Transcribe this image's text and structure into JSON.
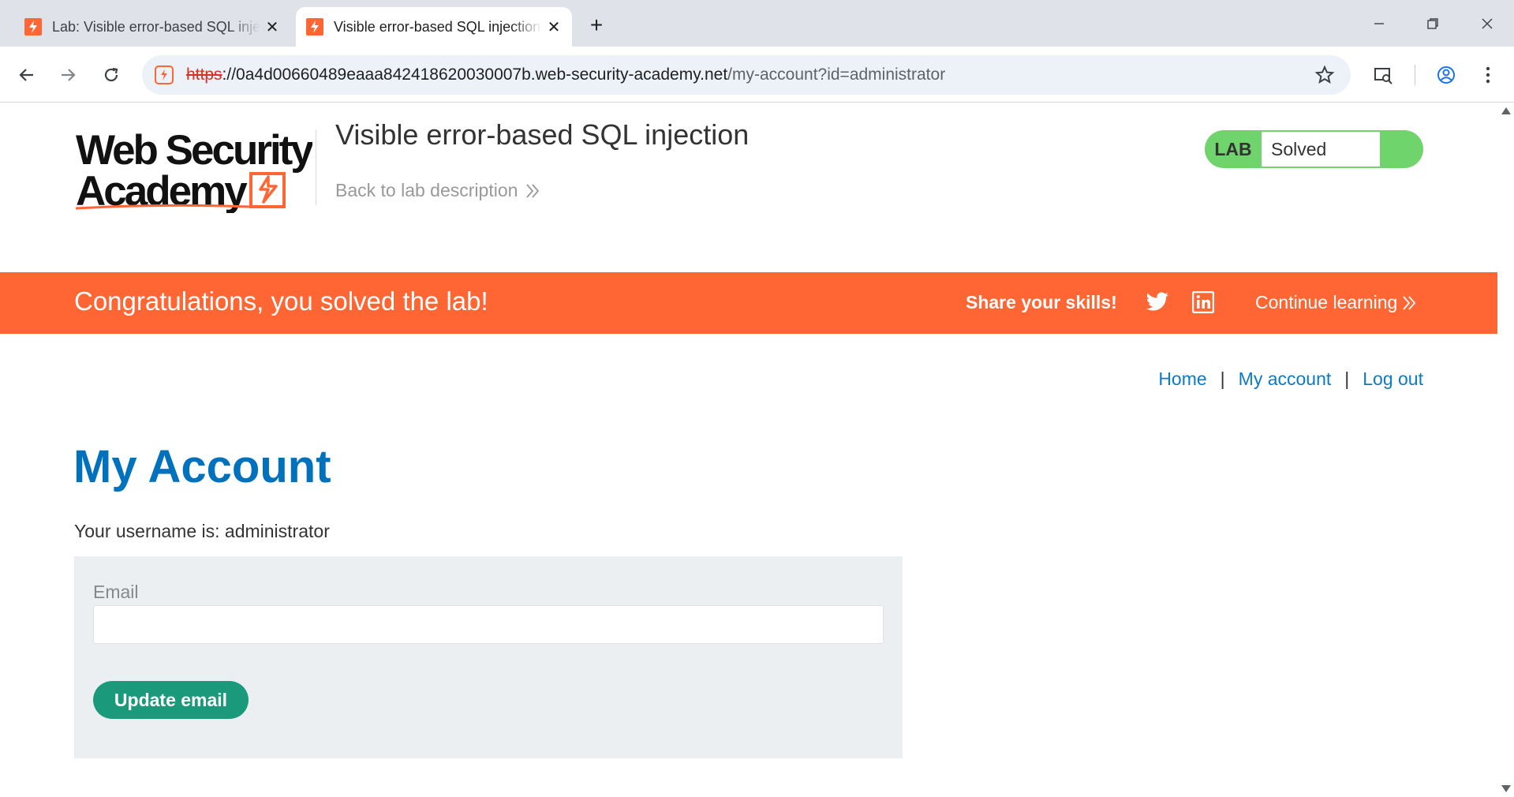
{
  "browser": {
    "tabs": [
      {
        "title": "Lab: Visible error-based SQL injection",
        "active": false
      },
      {
        "title": "Visible error-based SQL injection",
        "active": true
      }
    ],
    "url_scheme": "https",
    "url_sep": "://",
    "url_host": "0a4d00660489eaaa842418620030007b.web-security-academy.net",
    "url_path": "/my-account?id=administrator",
    "colors": {
      "brand": "#ff6633",
      "tabstrip": "#dfe3e9"
    }
  },
  "header": {
    "logo_line1": "Web Security",
    "logo_line2": "Academy",
    "lab_title": "Visible error-based SQL injection",
    "back_link": "Back to lab description",
    "lab_badge": "LAB",
    "lab_status": "Solved",
    "status_color": "#70d46c"
  },
  "banner": {
    "message": "Congratulations, you solved the lab!",
    "share": "Share your skills!",
    "continue": "Continue learning",
    "social_icons": [
      "twitter-icon",
      "linkedin-icon"
    ]
  },
  "nav": {
    "home": "Home",
    "sep": "|",
    "my_account": "My account",
    "log_out": "Log out"
  },
  "main": {
    "heading": "My Account",
    "username_line": "Your username is: administrator",
    "email_label": "Email",
    "email_value": "",
    "update_button": "Update email"
  }
}
